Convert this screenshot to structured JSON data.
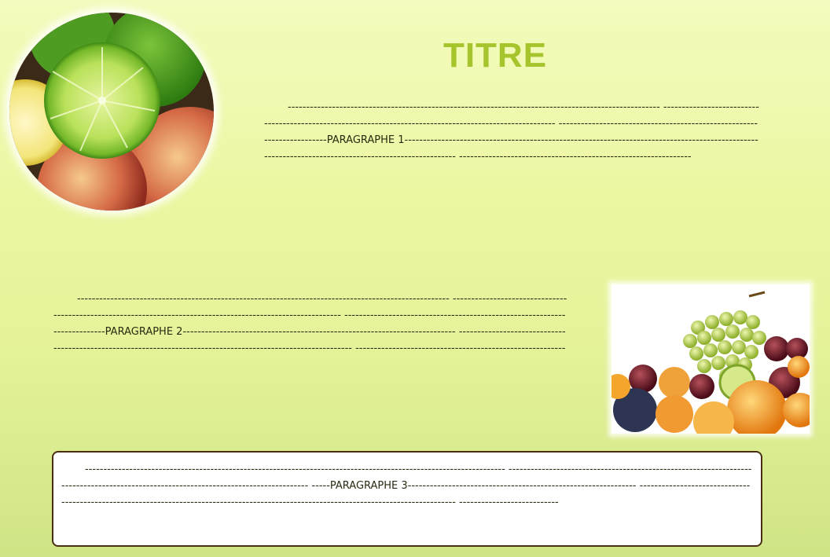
{
  "title": "TITRE",
  "paragraphs": {
    "p1": "----------------------------------------------------------------------------------------------------- --------------------------------------------------------------------------------------------------------- -----------------------------------------------------------------------PARAGRAPHE 1---------------------------------------------------------------------------------------------------------------------------------------------------- ---------------------------------------------------------------",
    "p2": "----------------------------------------------------------------------------------------------------- ------------------------------------------------------------------------------------------------------------- --------------------------------------------------------------------------PARAGRAPHE 2-------------------------------------------------------------------------- -------------------------------------------------------------------------------------------------------------- ---------------------------------------------------------",
    "p3": "------------------------------------------------------------------------------------------------------------------ ------------------------------------------------------------------------------------------------------------------------------------- -----PARAGRAPHE 3-------------------------------------------------------------- ----------------------------------------------------------------------------------------------------------------------------------------- ---------------------------"
  },
  "images": {
    "circle": "citrus-and-apples-photo",
    "rect": "grapes-and-fruits-photo"
  }
}
